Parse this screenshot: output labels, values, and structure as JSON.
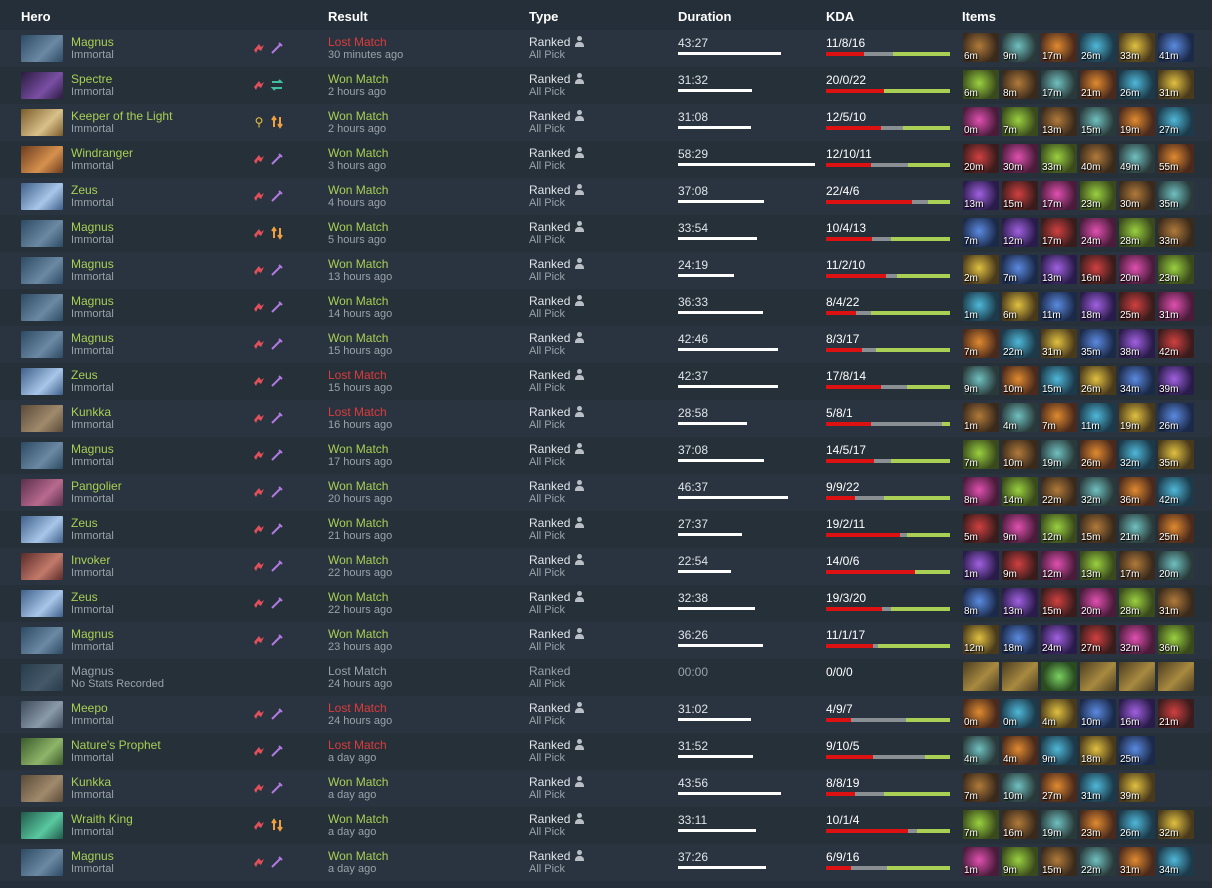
{
  "headers": {
    "hero": "Hero",
    "result": "Result",
    "type": "Type",
    "duration": "Duration",
    "kda": "KDA",
    "items": "Items"
  },
  "colors": {
    "won": "#a9cf54",
    "lost": "#dd3b3b",
    "kda_kill": "#dd1111",
    "kda_death": "#8a8f94",
    "kda_assist": "#a9cf54"
  },
  "icons": {
    "role_carry": "blood-drop-icon",
    "lane_mid": "sword-icon",
    "lane_safe": "arrows-swap-icon",
    "lane_off": "arrows-updown-icon",
    "role_support": "ward-icon",
    "player_type": "person-icon"
  },
  "matches": [
    {
      "hero": "Magnus",
      "rank": "Immortal",
      "result": "Lost Match",
      "res": "lost",
      "ago": "30 minutes ago",
      "type": "Ranked",
      "mode": "All Pick",
      "duration": "43:27",
      "dur_frac": 0.75,
      "kda": "11/8/16",
      "kf": 0.31,
      "df": 0.23,
      "icons": [
        "carry",
        "mid"
      ],
      "items": [
        "6m",
        "9m",
        "17m",
        "26m",
        "33m",
        "41m"
      ]
    },
    {
      "hero": "Spectre",
      "rank": "Immortal",
      "result": "Won Match",
      "res": "won",
      "ago": "2 hours ago",
      "type": "Ranked",
      "mode": "All Pick",
      "duration": "31:32",
      "dur_frac": 0.54,
      "kda": "20/0/22",
      "kf": 0.47,
      "df": 0.0,
      "icons": [
        "carry",
        "safe"
      ],
      "items": [
        "6m",
        "8m",
        "17m",
        "21m",
        "26m",
        "31m"
      ]
    },
    {
      "hero": "Keeper of the Light",
      "rank": "Immortal",
      "result": "Won Match",
      "res": "won",
      "ago": "2 hours ago",
      "type": "Ranked",
      "mode": "All Pick",
      "duration": "31:08",
      "dur_frac": 0.53,
      "kda": "12/5/10",
      "kf": 0.44,
      "df": 0.18,
      "icons": [
        "support",
        "off"
      ],
      "items": [
        "0m",
        "7m",
        "13m",
        "15m",
        "19m",
        "27m"
      ]
    },
    {
      "hero": "Windranger",
      "rank": "Immortal",
      "result": "Won Match",
      "res": "won",
      "ago": "3 hours ago",
      "type": "Ranked",
      "mode": "All Pick",
      "duration": "58:29",
      "dur_frac": 1.0,
      "kda": "12/10/11",
      "kf": 0.36,
      "df": 0.3,
      "icons": [
        "carry",
        "mid"
      ],
      "items": [
        "20m",
        "30m",
        "33m",
        "40m",
        "49m",
        "55m"
      ]
    },
    {
      "hero": "Zeus",
      "rank": "Immortal",
      "result": "Won Match",
      "res": "won",
      "ago": "4 hours ago",
      "type": "Ranked",
      "mode": "All Pick",
      "duration": "37:08",
      "dur_frac": 0.63,
      "kda": "22/4/6",
      "kf": 0.69,
      "df": 0.13,
      "icons": [
        "carry",
        "mid"
      ],
      "items": [
        "13m",
        "15m",
        "17m",
        "23m",
        "30m",
        "35m"
      ]
    },
    {
      "hero": "Magnus",
      "rank": "Immortal",
      "result": "Won Match",
      "res": "won",
      "ago": "5 hours ago",
      "type": "Ranked",
      "mode": "All Pick",
      "duration": "33:54",
      "dur_frac": 0.58,
      "kda": "10/4/13",
      "kf": 0.37,
      "df": 0.15,
      "icons": [
        "carry",
        "off"
      ],
      "items": [
        "7m",
        "12m",
        "17m",
        "24m",
        "28m",
        "33m"
      ]
    },
    {
      "hero": "Magnus",
      "rank": "Immortal",
      "result": "Won Match",
      "res": "won",
      "ago": "13 hours ago",
      "type": "Ranked",
      "mode": "All Pick",
      "duration": "24:19",
      "dur_frac": 0.41,
      "kda": "11/2/10",
      "kf": 0.48,
      "df": 0.09,
      "icons": [
        "carry",
        "mid"
      ],
      "items": [
        "2m",
        "7m",
        "13m",
        "16m",
        "20m",
        "23m"
      ]
    },
    {
      "hero": "Magnus",
      "rank": "Immortal",
      "result": "Won Match",
      "res": "won",
      "ago": "14 hours ago",
      "type": "Ranked",
      "mode": "All Pick",
      "duration": "36:33",
      "dur_frac": 0.62,
      "kda": "8/4/22",
      "kf": 0.24,
      "df": 0.12,
      "icons": [
        "carry",
        "mid"
      ],
      "items": [
        "1m",
        "6m",
        "11m",
        "18m",
        "25m",
        "31m"
      ]
    },
    {
      "hero": "Magnus",
      "rank": "Immortal",
      "result": "Won Match",
      "res": "won",
      "ago": "15 hours ago",
      "type": "Ranked",
      "mode": "All Pick",
      "duration": "42:46",
      "dur_frac": 0.73,
      "kda": "8/3/17",
      "kf": 0.29,
      "df": 0.11,
      "icons": [
        "carry",
        "mid"
      ],
      "items": [
        "7m",
        "22m",
        "31m",
        "35m",
        "38m",
        "42m"
      ]
    },
    {
      "hero": "Zeus",
      "rank": "Immortal",
      "result": "Lost Match",
      "res": "lost",
      "ago": "15 hours ago",
      "type": "Ranked",
      "mode": "All Pick",
      "duration": "42:37",
      "dur_frac": 0.73,
      "kda": "17/8/14",
      "kf": 0.44,
      "df": 0.21,
      "icons": [
        "carry",
        "mid"
      ],
      "items": [
        "9m",
        "10m",
        "15m",
        "26m",
        "34m",
        "39m"
      ]
    },
    {
      "hero": "Kunkka",
      "rank": "Immortal",
      "result": "Lost Match",
      "res": "lost",
      "ago": "16 hours ago",
      "type": "Ranked",
      "mode": "All Pick",
      "duration": "28:58",
      "dur_frac": 0.5,
      "kda": "5/8/1",
      "kf": 0.36,
      "df": 0.57,
      "icons": [
        "carry",
        "mid"
      ],
      "items": [
        "1m",
        "4m",
        "7m",
        "11m",
        "19m",
        "26m"
      ]
    },
    {
      "hero": "Magnus",
      "rank": "Immortal",
      "result": "Won Match",
      "res": "won",
      "ago": "17 hours ago",
      "type": "Ranked",
      "mode": "All Pick",
      "duration": "37:08",
      "dur_frac": 0.63,
      "kda": "14/5/17",
      "kf": 0.39,
      "df": 0.14,
      "icons": [
        "carry",
        "mid"
      ],
      "items": [
        "7m",
        "10m",
        "19m",
        "26m",
        "32m",
        "35m"
      ]
    },
    {
      "hero": "Pangolier",
      "rank": "Immortal",
      "result": "Won Match",
      "res": "won",
      "ago": "20 hours ago",
      "type": "Ranked",
      "mode": "All Pick",
      "duration": "46:37",
      "dur_frac": 0.8,
      "kda": "9/9/22",
      "kf": 0.23,
      "df": 0.23,
      "icons": [
        "carry",
        "mid"
      ],
      "items": [
        "8m",
        "14m",
        "22m",
        "32m",
        "36m",
        "42m"
      ]
    },
    {
      "hero": "Zeus",
      "rank": "Immortal",
      "result": "Won Match",
      "res": "won",
      "ago": "21 hours ago",
      "type": "Ranked",
      "mode": "All Pick",
      "duration": "27:37",
      "dur_frac": 0.47,
      "kda": "19/2/11",
      "kf": 0.6,
      "df": 0.06,
      "icons": [
        "carry",
        "mid"
      ],
      "items": [
        "5m",
        "9m",
        "12m",
        "15m",
        "21m",
        "25m"
      ]
    },
    {
      "hero": "Invoker",
      "rank": "Immortal",
      "result": "Won Match",
      "res": "won",
      "ago": "22 hours ago",
      "type": "Ranked",
      "mode": "All Pick",
      "duration": "22:54",
      "dur_frac": 0.39,
      "kda": "14/0/6",
      "kf": 0.72,
      "df": 0.0,
      "icons": [
        "carry",
        "mid"
      ],
      "items": [
        "1m",
        "9m",
        "12m",
        "13m",
        "17m",
        "20m"
      ]
    },
    {
      "hero": "Zeus",
      "rank": "Immortal",
      "result": "Won Match",
      "res": "won",
      "ago": "22 hours ago",
      "type": "Ranked",
      "mode": "All Pick",
      "duration": "32:38",
      "dur_frac": 0.56,
      "kda": "19/3/20",
      "kf": 0.45,
      "df": 0.07,
      "icons": [
        "carry",
        "mid"
      ],
      "items": [
        "8m",
        "13m",
        "15m",
        "20m",
        "28m",
        "31m"
      ]
    },
    {
      "hero": "Magnus",
      "rank": "Immortal",
      "result": "Won Match",
      "res": "won",
      "ago": "23 hours ago",
      "type": "Ranked",
      "mode": "All Pick",
      "duration": "36:26",
      "dur_frac": 0.62,
      "kda": "11/1/17",
      "kf": 0.38,
      "df": 0.04,
      "icons": [
        "carry",
        "mid"
      ],
      "items": [
        "12m",
        "18m",
        "24m",
        "27m",
        "32m",
        "36m"
      ]
    },
    {
      "hero": "Magnus",
      "rank": "No Stats Recorded",
      "result": "Lost Match",
      "res": "nostat",
      "ago": "24 hours ago",
      "type": "Ranked",
      "mode": "All Pick",
      "duration": "00:00",
      "dur_frac": 0,
      "kda": "0/0/0",
      "kf": 0,
      "df": 0,
      "icons": [],
      "items": [
        "",
        "",
        "",
        "",
        "",
        ""
      ],
      "nostat": true
    },
    {
      "hero": "Meepo",
      "rank": "Immortal",
      "result": "Lost Match",
      "res": "lost",
      "ago": "24 hours ago",
      "type": "Ranked",
      "mode": "All Pick",
      "duration": "31:02",
      "dur_frac": 0.53,
      "kda": "4/9/7",
      "kf": 0.2,
      "df": 0.44,
      "icons": [
        "carry",
        "mid"
      ],
      "items": [
        "0m",
        "0m",
        "4m",
        "10m",
        "16m",
        "21m"
      ]
    },
    {
      "hero": "Nature's Prophet",
      "rank": "Immortal",
      "result": "Lost Match",
      "res": "lost",
      "ago": "a day ago",
      "type": "Ranked",
      "mode": "All Pick",
      "duration": "31:52",
      "dur_frac": 0.55,
      "kda": "9/10/5",
      "kf": 0.38,
      "df": 0.42,
      "icons": [
        "carry",
        "mid"
      ],
      "items": [
        "4m",
        "4m",
        "9m",
        "18m",
        "25m"
      ]
    },
    {
      "hero": "Kunkka",
      "rank": "Immortal",
      "result": "Won Match",
      "res": "won",
      "ago": "a day ago",
      "type": "Ranked",
      "mode": "All Pick",
      "duration": "43:56",
      "dur_frac": 0.75,
      "kda": "8/8/19",
      "kf": 0.23,
      "df": 0.23,
      "icons": [
        "carry",
        "mid"
      ],
      "items": [
        "7m",
        "10m",
        "27m",
        "31m",
        "39m"
      ]
    },
    {
      "hero": "Wraith King",
      "rank": "Immortal",
      "result": "Won Match",
      "res": "won",
      "ago": "a day ago",
      "type": "Ranked",
      "mode": "All Pick",
      "duration": "33:11",
      "dur_frac": 0.57,
      "kda": "10/1/4",
      "kf": 0.66,
      "df": 0.07,
      "icons": [
        "carry",
        "off"
      ],
      "items": [
        "7m",
        "16m",
        "19m",
        "23m",
        "26m",
        "32m"
      ]
    },
    {
      "hero": "Magnus",
      "rank": "Immortal",
      "result": "Won Match",
      "res": "won",
      "ago": "a day ago",
      "type": "Ranked",
      "mode": "All Pick",
      "duration": "37:26",
      "dur_frac": 0.64,
      "kda": "6/9/16",
      "kf": 0.2,
      "df": 0.29,
      "icons": [
        "carry",
        "mid"
      ],
      "items": [
        "1m",
        "9m",
        "15m",
        "22m",
        "31m",
        "34m"
      ]
    }
  ]
}
